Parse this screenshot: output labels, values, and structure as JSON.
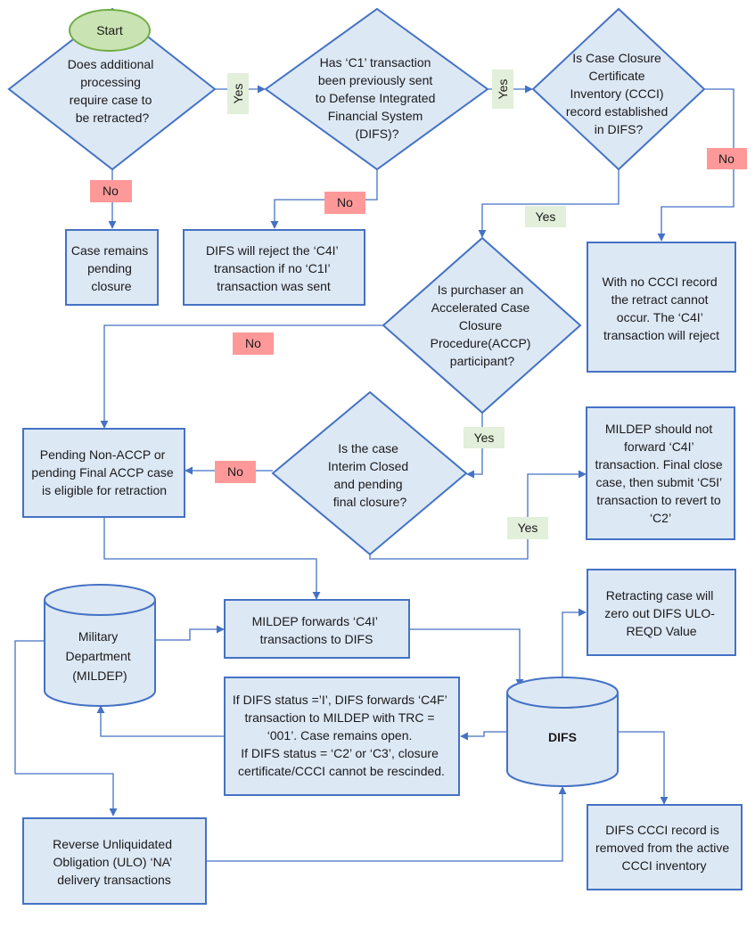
{
  "colors": {
    "shape_fill": "#dde8f5",
    "shape_stroke": "#4472c4",
    "start_fill": "#c9e3b2",
    "start_stroke": "#70ad47",
    "yes_fill": "#e2efda",
    "no_fill": "#ff9999",
    "connector": "#4472c4"
  },
  "start": {
    "label": "Start"
  },
  "decisions": {
    "retract": [
      "Does additional",
      "processing",
      "require case to",
      "be retracted?"
    ],
    "c1_sent": [
      "Has ‘C1’ transaction",
      "been previously sent",
      "to Defense Integrated",
      "Financial System",
      "(DIFS)?"
    ],
    "ccci": [
      "Is Case Closure",
      "Certificate",
      "Inventory (CCCI)",
      "record established",
      "in DIFS?"
    ],
    "accp": [
      "Is purchaser an",
      "Accelerated Case",
      "Closure",
      "Procedure(ACCP)",
      "participant?"
    ],
    "interim": [
      "Is the case",
      "Interim Closed",
      "and pending",
      "final closure?"
    ]
  },
  "processes": {
    "remains_pending": [
      "Case remains",
      "pending",
      "closure"
    ],
    "difs_reject": [
      "DIFS will reject the ‘C4I’",
      "transaction if no ‘C1I’",
      "transaction was sent"
    ],
    "no_ccci": [
      "With no CCCI record",
      "the retract cannot",
      "occur.  The ‘C4I’",
      "transaction will reject"
    ],
    "eligible": [
      "Pending Non-ACCP or",
      "pending Final ACCP case",
      "is eligible for retraction"
    ],
    "mildep_should_not": [
      "MILDEP should not",
      "forward ‘C4I’",
      "transaction.  Final close",
      "case, then submit ‘C5I’",
      "transaction to revert to",
      "‘C2’"
    ],
    "mildep_forwards": [
      "MILDEP forwards ‘C4I’",
      "transactions to DIFS"
    ],
    "retracting_zero": [
      "Retracting case will",
      "zero out DIFS ULO-",
      "REQD Value"
    ],
    "difs_status": [
      "If DIFS status =’I’, DIFS forwards ‘C4F’",
      "transaction to MILDEP with TRC =",
      "‘001’.  Case remains open.",
      "If DIFS status = ‘C2’ or ‘C3’, closure",
      "certificate/CCCI cannot be rescinded."
    ],
    "reverse_ulo": [
      "Reverse Unliquidated",
      "Obligation (ULO) ‘NA’",
      "delivery transactions"
    ],
    "ccci_removed": [
      "DIFS CCCI record is",
      "removed from the active",
      "CCCI inventory"
    ]
  },
  "databases": {
    "mildep": [
      "Military",
      "Department",
      "(MILDEP)"
    ],
    "difs": [
      "DIFS"
    ]
  },
  "edge_labels": {
    "yes": "Yes",
    "no": "No"
  }
}
